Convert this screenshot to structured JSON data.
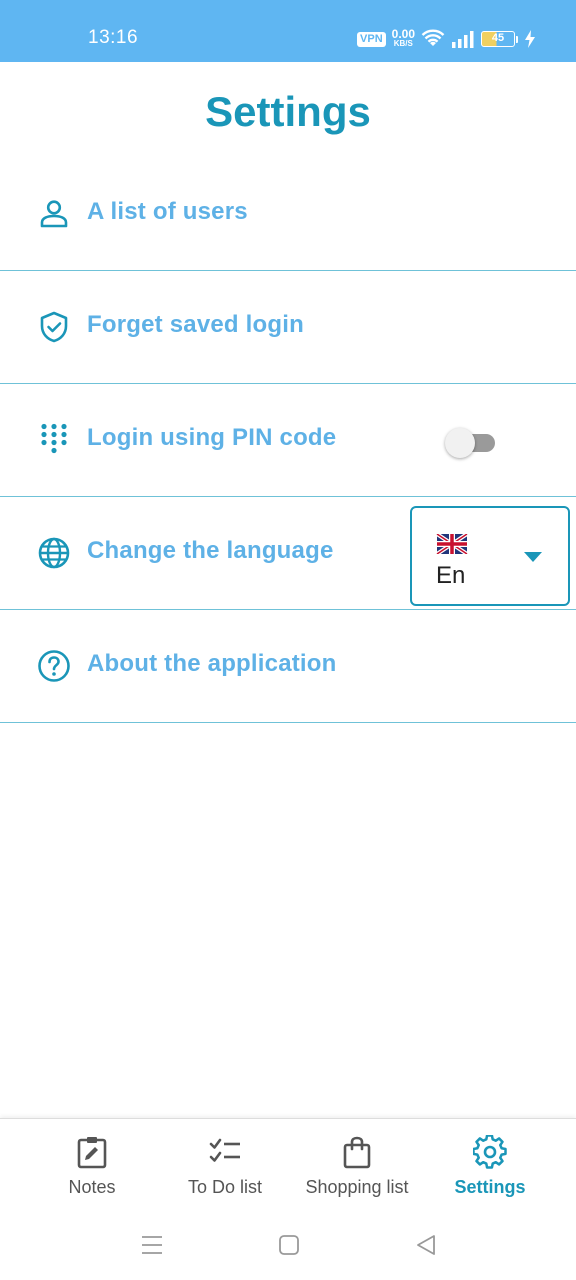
{
  "status_bar": {
    "time": "13:16",
    "vpn_label": "VPN",
    "net_speed": "0.00",
    "net_unit": "KB/S",
    "battery_level": "45",
    "background_color": "#5fb6f2"
  },
  "header": {
    "title": "Settings",
    "title_color": "#1a96b8"
  },
  "settings": {
    "items": [
      {
        "label": "A list of users",
        "icon": "user-icon"
      },
      {
        "label": "Forget saved login",
        "icon": "shield-check-icon"
      },
      {
        "label": "Login using PIN code",
        "icon": "dialpad-icon",
        "toggle_on": false
      },
      {
        "label": "Change the language",
        "icon": "globe-icon"
      },
      {
        "label": "About the application",
        "icon": "help-circle-icon"
      }
    ],
    "label_color": "#5eb1e6",
    "icon_color": "#1a96b8",
    "divider_color": "#6fc2d8"
  },
  "language": {
    "selected_value": "En",
    "flag_icon": "uk-flag-icon"
  },
  "bottom_nav": {
    "items": [
      {
        "label": "Notes",
        "icon": "notes-edit-icon"
      },
      {
        "label": "To Do list",
        "icon": "checklist-icon"
      },
      {
        "label": "Shopping list",
        "icon": "shopping-bag-icon"
      },
      {
        "label": "Settings",
        "icon": "gear-icon",
        "active": true
      }
    ],
    "active_color": "#1a96b8",
    "inactive_color": "#555555"
  },
  "system_nav": {
    "icons": [
      "menu-icon",
      "home-square-icon",
      "back-triangle-icon"
    ]
  }
}
